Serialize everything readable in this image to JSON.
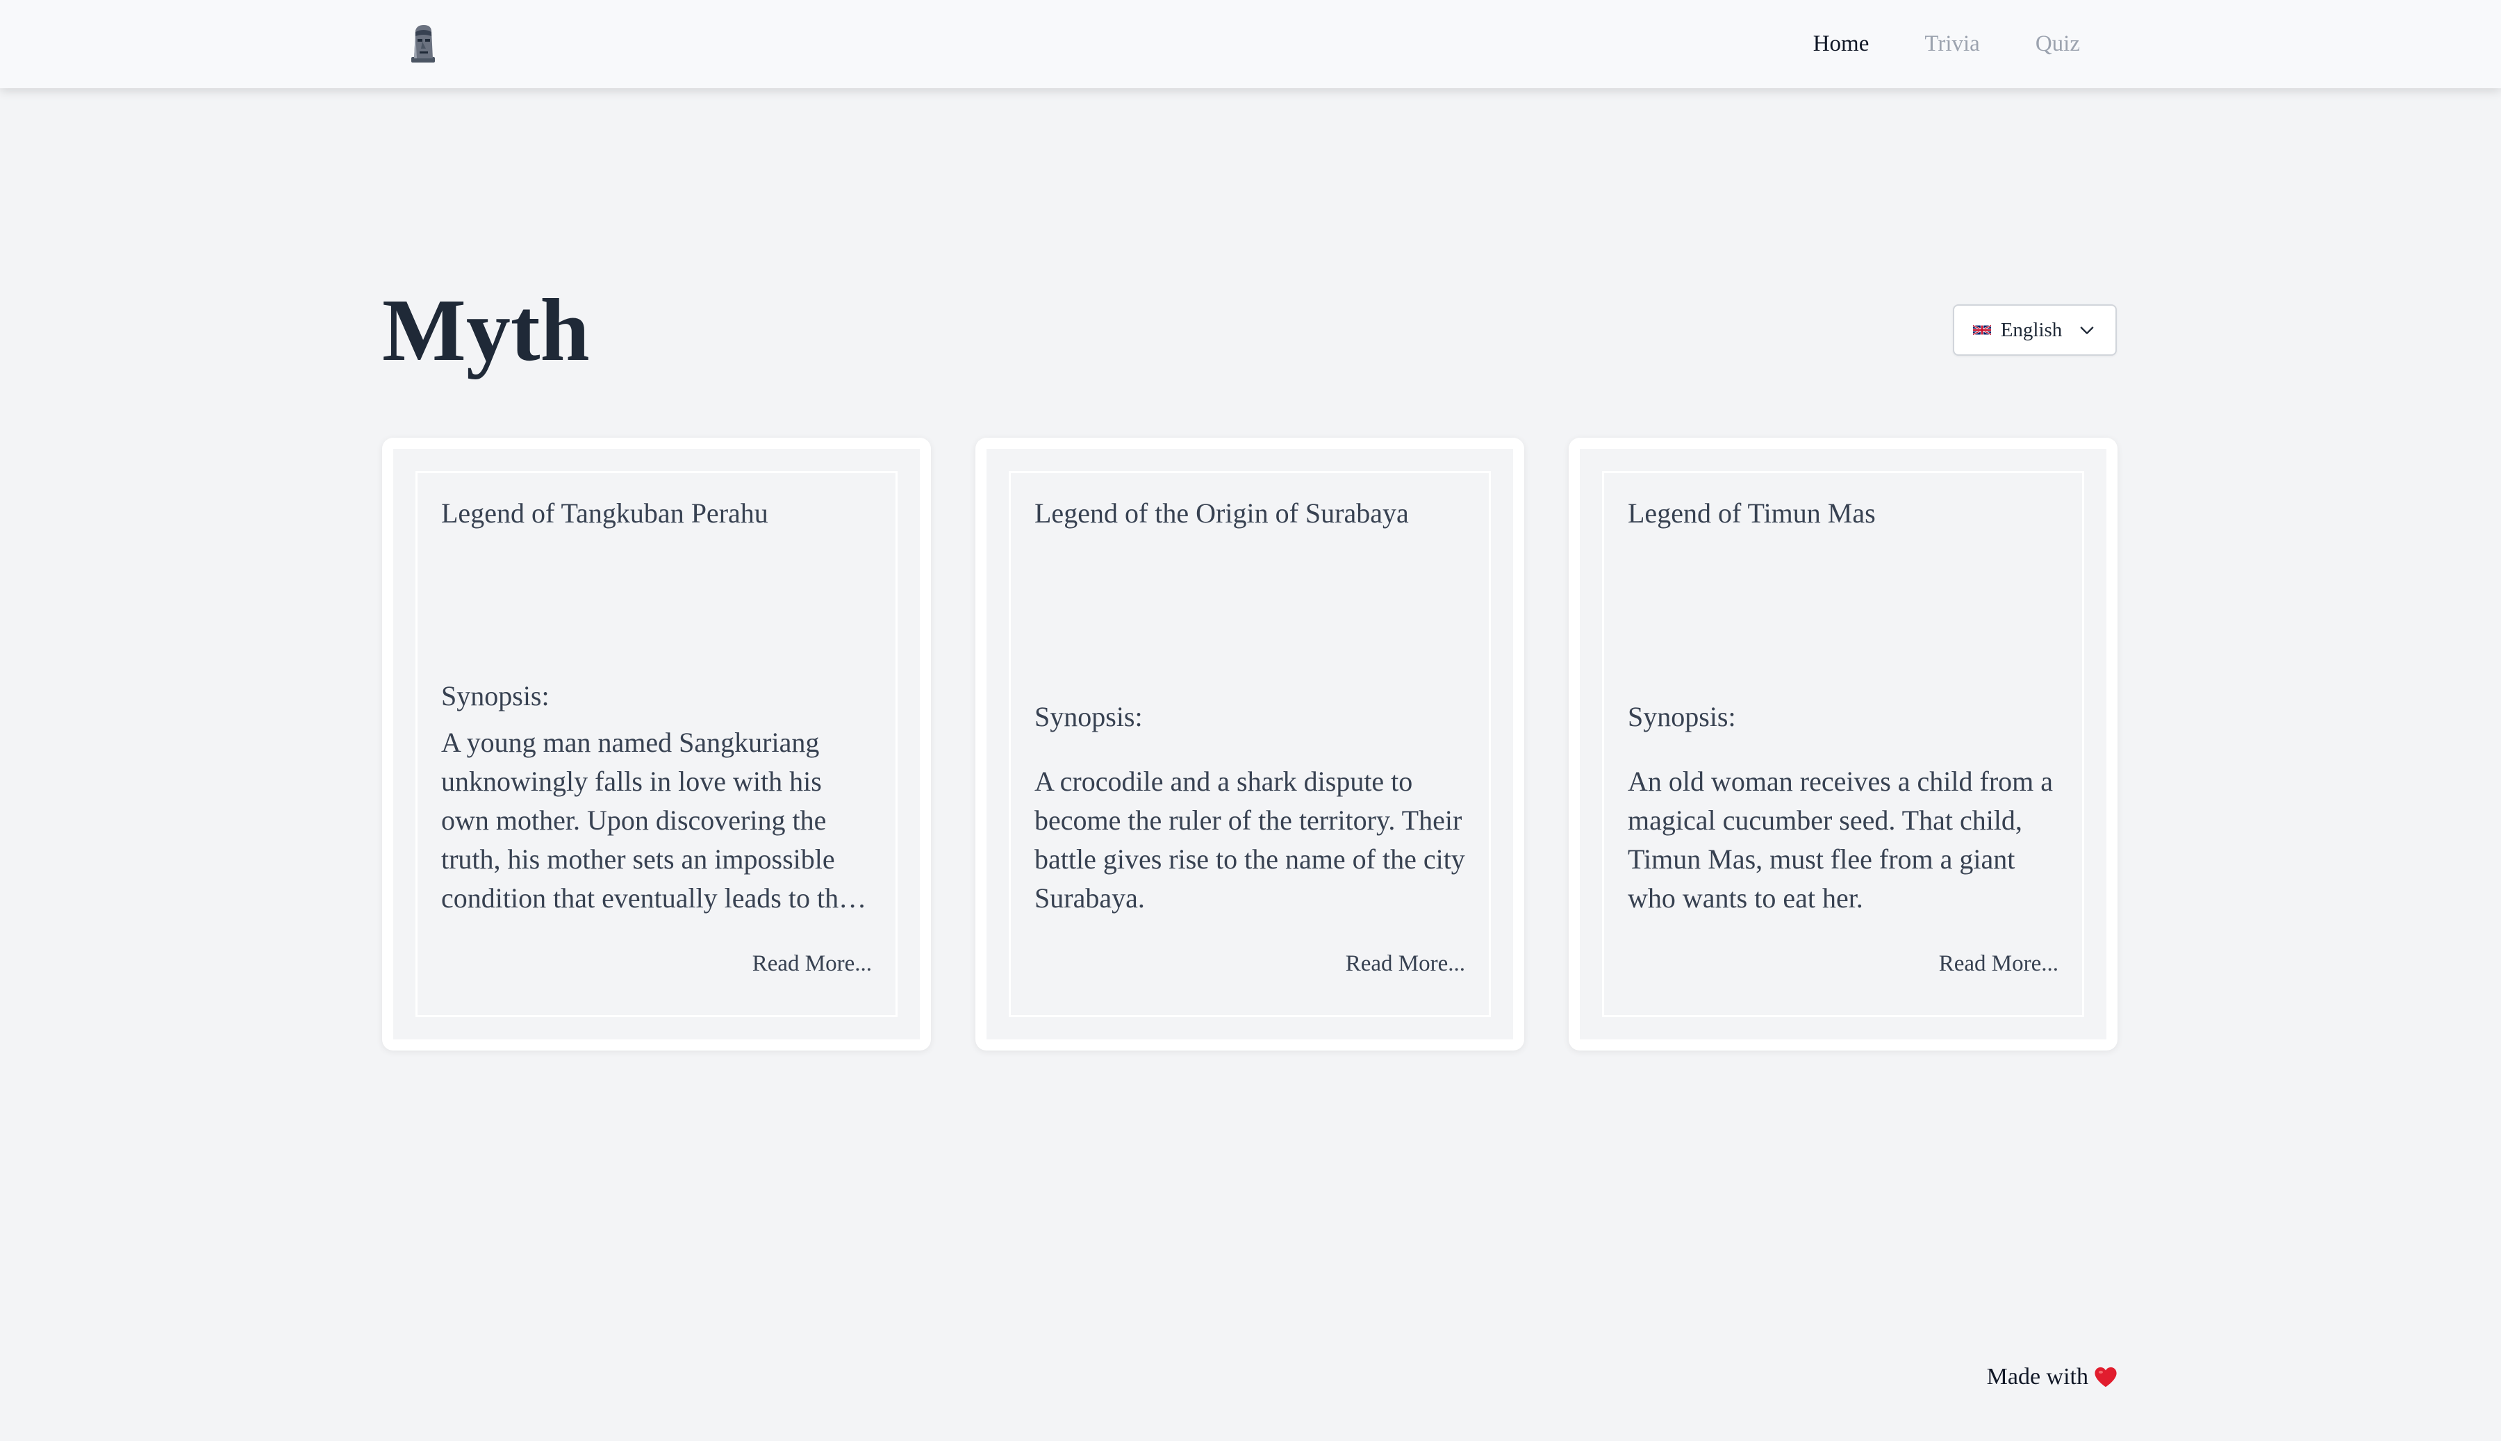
{
  "nav": {
    "logo_icon": "moai-statue-icon",
    "links": [
      {
        "label": "Home",
        "active": true
      },
      {
        "label": "Trivia",
        "active": false
      },
      {
        "label": "Quiz",
        "active": false
      }
    ]
  },
  "header": {
    "title": "Myth",
    "language": {
      "flag_icon": "uk-flag-icon",
      "selected": "English"
    }
  },
  "cards": [
    {
      "title": "Legend of Tangkuban Perahu",
      "synopsis_label": "Synopsis:",
      "synopsis": "A young man named Sangkuriang unknowingly falls in love with his own mother. Upon discovering the truth, his mother sets an impossible condition that eventually leads to the formation of Mount Tangkuban Perahu.",
      "read_more": "Read More..."
    },
    {
      "title": "Legend of the Origin of Surabaya",
      "synopsis_label": "Synopsis:",
      "synopsis": "A crocodile and a shark dispute to become the ruler of the territory. Their battle gives rise to the name of the city Surabaya.",
      "read_more": "Read More..."
    },
    {
      "title": "Legend of Timun Mas",
      "synopsis_label": "Synopsis:",
      "synopsis": "An old woman receives a child from a magical cucumber seed. That child, Timun Mas, must flee from a giant who wants to eat her.",
      "read_more": "Read More..."
    }
  ],
  "footer": {
    "text": "Made with",
    "icon": "heart-icon",
    "heart_color": "#e11d2e"
  },
  "colors": {
    "background": "#f3f4f6",
    "navbar": "#f8f9fb",
    "title": "#1f2937",
    "text": "#374151",
    "nav_inactive": "#9ca3af"
  }
}
